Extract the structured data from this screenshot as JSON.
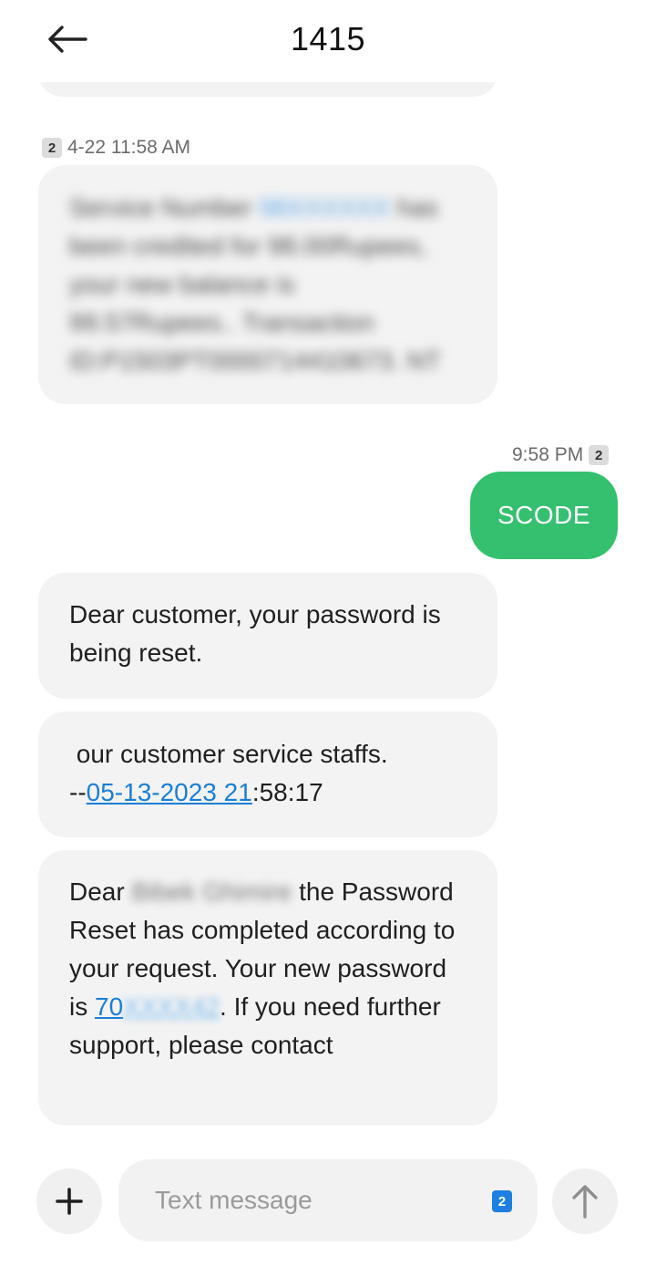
{
  "header": {
    "title": "1415",
    "back_icon": "arrow-left-icon"
  },
  "messages": [
    {
      "direction": "incoming",
      "sim": "2",
      "timestamp": "4-22 11:58 AM",
      "text_parts": [
        "Service Number ",
        "98XXXXXX",
        " has been credited for 98.00Rupees, your new balance is 99.57Rupees.. Transaction ID:P1503PT0000714410673. NT"
      ],
      "blurred": true
    },
    {
      "direction": "outgoing",
      "sim": "2",
      "timestamp": "9:58 PM",
      "text": "SCODE"
    },
    {
      "direction": "incoming",
      "text": "Dear customer, your password is being reset."
    },
    {
      "direction": "incoming",
      "line1": " our customer service staffs.",
      "prefix": "--",
      "link": "05-13-2023 21",
      "suffix": ":58:17"
    },
    {
      "direction": "incoming",
      "dear": "Dear ",
      "name_blurred": "Bibek Ghimire",
      "after_name": " the Password Reset has completed according to your request. Your new password is ",
      "password_link_visible": "70",
      "password_link_blurred": "XXXX42",
      "after_password": ". If you need further support, please contact"
    }
  ],
  "composer": {
    "placeholder": "Text message",
    "sim": "2",
    "add_icon": "plus-icon",
    "send_icon": "arrow-up-icon"
  },
  "colors": {
    "outgoing_bubble": "#34c06f",
    "incoming_bubble": "#f3f3f3",
    "link": "#1a7fd6",
    "sim_badge_active": "#1e7fe0"
  }
}
